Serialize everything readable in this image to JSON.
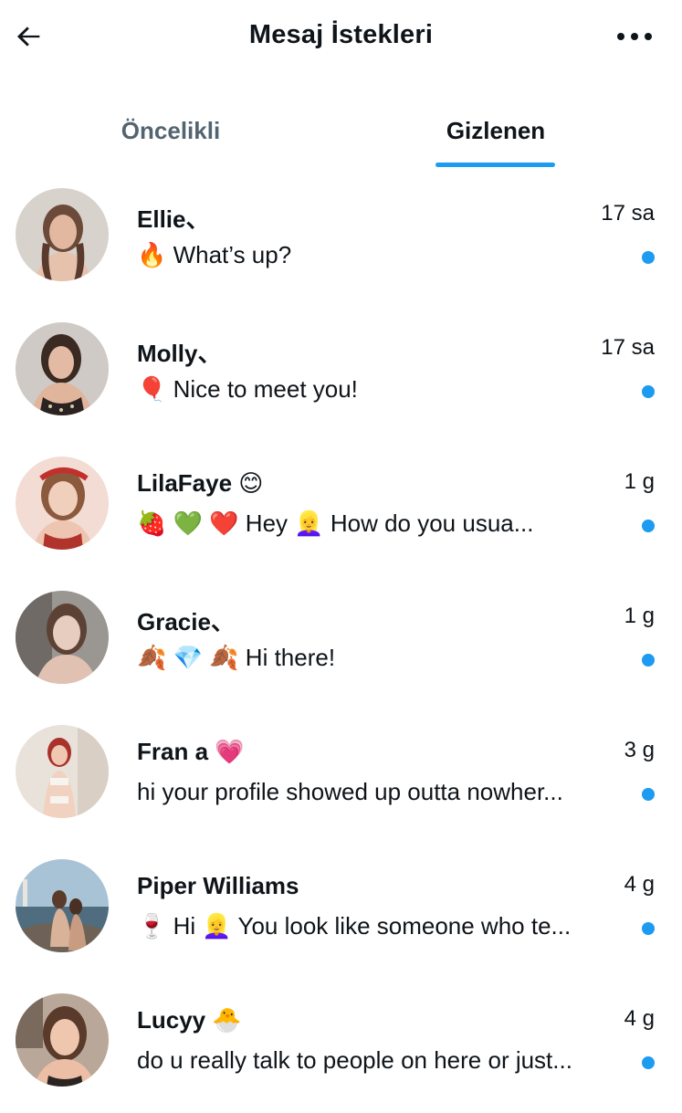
{
  "header": {
    "title": "Mesaj İstekleri"
  },
  "tabs": [
    {
      "label": "Öncelikli",
      "active": false
    },
    {
      "label": "Gizlenen",
      "active": true
    }
  ],
  "colors": {
    "accent": "#1d9bf0",
    "inactive_tab": "#536471",
    "text": "#0f1419"
  },
  "conversations": [
    {
      "name": "Ellie、",
      "time": "17 sa",
      "preview": "🔥 What’s up?",
      "unread": true
    },
    {
      "name": "Molly、",
      "time": "17 sa",
      "preview": "🎈 Nice to meet you!",
      "unread": true
    },
    {
      "name": "LilaFaye 😊",
      "time": "1 g",
      "preview": "🍓 💚    ❤️ Hey 👱‍♀️ How do you usua...",
      "unread": true
    },
    {
      "name": "Gracie、",
      "time": "1 g",
      "preview": "🍂 💎 🍂 Hi there!",
      "unread": true
    },
    {
      "name": "Fran a 💗",
      "time": "3 g",
      "preview": "hi your profile showed up outta nowher...",
      "unread": true
    },
    {
      "name": "Piper Williams",
      "time": "4 g",
      "preview": "🍷 Hi 👱‍♀️ You look like someone who te...",
      "unread": true
    },
    {
      "name": "Lucyy 🐣",
      "time": "4 g",
      "preview": "do u really talk to people on here or just...",
      "unread": true
    }
  ],
  "icons": {
    "back": "arrow-left-icon",
    "more": "more-horizontal-icon"
  }
}
